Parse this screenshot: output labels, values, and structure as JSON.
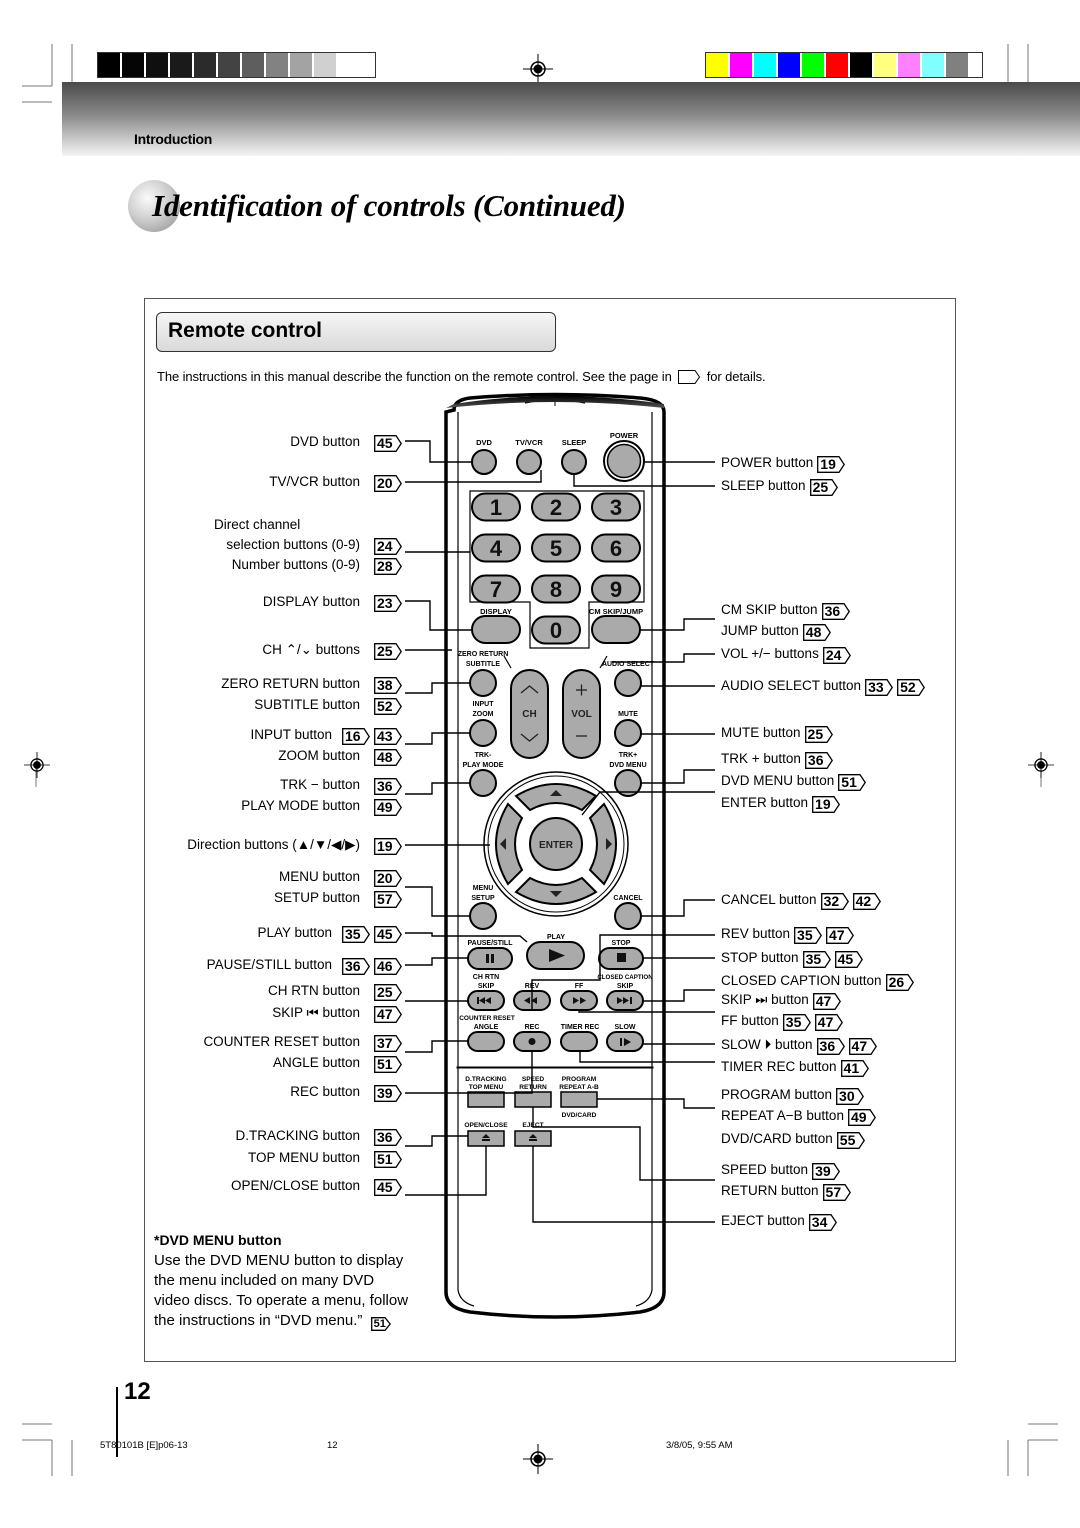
{
  "print_marks": {
    "grayscale_bars": [
      "#000000",
      "#050505",
      "#0f0f0f",
      "#1a1a1a",
      "#2b2b2b",
      "#434343",
      "#5e5e5e",
      "#828282",
      "#a3a3a3",
      "#d0d0d0",
      "#ffffff"
    ],
    "color_bars": [
      "#ffff00",
      "#ff00ff",
      "#00ffff",
      "#0000ff",
      "#00ff00",
      "#ff0000",
      "#000000",
      "#ffff80",
      "#ff80ff",
      "#80ffff",
      "#808080"
    ]
  },
  "header": {
    "section": "Introduction",
    "title": "Identification of controls (Continued)"
  },
  "panel": {
    "heading": "Remote control",
    "intro_before": "The instructions in this manual describe the function on the remote control. See the page in",
    "intro_after": "for details."
  },
  "remote": {
    "keys": {
      "dvd": "DVD",
      "tvvcr": "TV/VCR",
      "sleep": "SLEEP",
      "power": "POWER",
      "digits": [
        "1",
        "2",
        "3",
        "4",
        "5",
        "6",
        "7",
        "8",
        "9",
        "0"
      ],
      "display": "DISPLAY",
      "cmskip": "CM SKIP/JUMP",
      "zero_return": "ZERO RETURN",
      "subtitle": "SUBTITLE",
      "audio_select": "AUDIO SELECT",
      "input": "INPUT",
      "zoom": "ZOOM",
      "ch": "CH",
      "vol": "VOL",
      "mute": "MUTE",
      "trk_minus": "TRK-",
      "play_mode": "PLAY MODE",
      "trk_plus": "TRK+",
      "dvd_menu": "DVD MENU",
      "enter": "ENTER",
      "menu": "MENU",
      "setup": "SETUP",
      "cancel": "CANCEL",
      "pause_still": "PAUSE/STILL",
      "play": "PLAY",
      "stop": "STOP",
      "ch_rtn": "CH RTN",
      "skip": "SKIP",
      "rev": "REV",
      "ff": "FF",
      "closed_caption": "CLOSED CAPTION",
      "counter_reset": "COUNTER RESET",
      "angle": "ANGLE",
      "rec": "REC",
      "timer_rec": "TIMER REC",
      "slow": "SLOW",
      "d_tracking": "D.TRACKING",
      "top_menu": "TOP MENU",
      "speed": "SPEED",
      "return": "RETURN",
      "program": "PROGRAM",
      "repeat_ab": "REPEAT A-B",
      "dvd_card": "DVD/CARD",
      "open_close": "OPEN/CLOSE",
      "eject": "EJECT"
    }
  },
  "callouts_left": [
    {
      "label": "DVD button",
      "refs": [
        "45"
      ]
    },
    {
      "label": "TV/VCR button",
      "refs": [
        "20"
      ]
    },
    {
      "label": "Direct channel",
      "refs": []
    },
    {
      "label": "selection buttons (0-9)",
      "refs": [
        "24"
      ]
    },
    {
      "label": "Number buttons (0-9)",
      "refs": [
        "28"
      ]
    },
    {
      "label": "DISPLAY button",
      "refs": [
        "23"
      ]
    },
    {
      "label": "CH ⌃/⌄ buttons",
      "refs": [
        "25"
      ]
    },
    {
      "label": "ZERO RETURN button",
      "refs": [
        "38"
      ]
    },
    {
      "label": "SUBTITLE button",
      "refs": [
        "52"
      ]
    },
    {
      "label": "INPUT button",
      "refs": [
        "16",
        "43"
      ]
    },
    {
      "label": "ZOOM button",
      "refs": [
        "48"
      ]
    },
    {
      "label": "TRK − button",
      "refs": [
        "36"
      ]
    },
    {
      "label": "PLAY MODE button",
      "refs": [
        "49"
      ]
    },
    {
      "label": "Direction buttons (▲/▼/◀/▶)",
      "refs": [
        "19"
      ]
    },
    {
      "label": "MENU button",
      "refs": [
        "20"
      ]
    },
    {
      "label": "SETUP button",
      "refs": [
        "57"
      ]
    },
    {
      "label": "PLAY button",
      "refs": [
        "35",
        "45"
      ]
    },
    {
      "label": "PAUSE/STILL button",
      "refs": [
        "36",
        "46"
      ]
    },
    {
      "label": "CH RTN button",
      "refs": [
        "25"
      ]
    },
    {
      "label": "SKIP ⏮ button",
      "refs": [
        "47"
      ]
    },
    {
      "label": "COUNTER RESET button",
      "refs": [
        "37"
      ]
    },
    {
      "label": "ANGLE button",
      "refs": [
        "51"
      ]
    },
    {
      "label": "REC button",
      "refs": [
        "39"
      ]
    },
    {
      "label": "D.TRACKING button",
      "refs": [
        "36"
      ]
    },
    {
      "label": "TOP MENU button",
      "refs": [
        "51"
      ]
    },
    {
      "label": "OPEN/CLOSE button",
      "refs": [
        "45"
      ]
    }
  ],
  "callouts_right": [
    {
      "label": "POWER button",
      "refs": [
        "19"
      ]
    },
    {
      "label": "SLEEP button",
      "refs": [
        "25"
      ]
    },
    {
      "label": "CM SKIP button",
      "refs": [
        "36"
      ]
    },
    {
      "label": "JUMP button",
      "refs": [
        "48"
      ]
    },
    {
      "label": "VOL +/−  buttons",
      "refs": [
        "24"
      ]
    },
    {
      "label": "AUDIO SELECT button",
      "refs": [
        "33",
        "52"
      ]
    },
    {
      "label": "MUTE button",
      "refs": [
        "25"
      ]
    },
    {
      "label": "TRK + button",
      "refs": [
        "36"
      ]
    },
    {
      "label": "DVD MENU button",
      "refs": [
        "51"
      ]
    },
    {
      "label": "ENTER button",
      "refs": [
        "19"
      ]
    },
    {
      "label": "CANCEL button",
      "refs": [
        "32",
        "42"
      ]
    },
    {
      "label": "REV button",
      "refs": [
        "35",
        "47"
      ]
    },
    {
      "label": "STOP button",
      "refs": [
        "35",
        "45"
      ]
    },
    {
      "label": "CLOSED CAPTION button",
      "refs": [
        "26"
      ]
    },
    {
      "label": "SKIP ⏭ button",
      "refs": [
        "47"
      ]
    },
    {
      "label": "FF button",
      "refs": [
        "35",
        "47"
      ]
    },
    {
      "label": "SLOW ⏵ button",
      "refs": [
        "36",
        "47"
      ]
    },
    {
      "label": "TIMER REC button",
      "refs": [
        "41"
      ]
    },
    {
      "label": "PROGRAM button",
      "refs": [
        "30"
      ]
    },
    {
      "label": "REPEAT A−B button",
      "refs": [
        "49"
      ]
    },
    {
      "label": "DVD/CARD button",
      "refs": [
        "55"
      ]
    },
    {
      "label": "SPEED button",
      "refs": [
        "39"
      ]
    },
    {
      "label": "RETURN button",
      "refs": [
        "57"
      ]
    },
    {
      "label": "EJECT button",
      "refs": [
        "34"
      ]
    }
  ],
  "note": {
    "heading": "*DVD MENU button",
    "body": "Use the DVD MENU button to display the menu included on many DVD video discs. To operate a menu, follow the instructions in “DVD menu.”",
    "ref": "51"
  },
  "footer": {
    "page_number": "12",
    "file": "5T80101B [E]p06-13",
    "sheet": "12",
    "timestamp": "3/8/05, 9:55 AM"
  }
}
